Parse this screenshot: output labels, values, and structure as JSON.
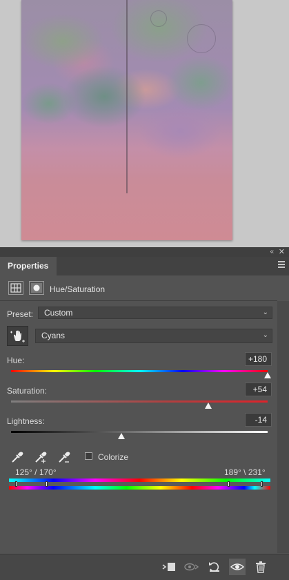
{
  "panel": {
    "tab_label": "Properties",
    "adjustment_title": "Hue/Saturation"
  },
  "preset": {
    "label": "Preset:",
    "value": "Custom"
  },
  "channel": {
    "value": "Cyans"
  },
  "hue": {
    "label": "Hue:",
    "value": "+180",
    "level_fraction": 1.0
  },
  "saturation": {
    "label": "Saturation:",
    "value": "+54",
    "level_fraction": 0.77
  },
  "lightness": {
    "label": "Lightness:",
    "value": "-14",
    "level_fraction": 0.43
  },
  "colorize": {
    "label": "Colorize",
    "checked": false
  },
  "range": {
    "left_label": "125° / 170°",
    "right_label": "189° \\ 231°"
  },
  "icons": {
    "collapse": "double-chevron-icon",
    "close": "close-icon",
    "panel_menu": "hamburger-icon",
    "adjustment": "hue-saturation-icon",
    "mask": "mask-icon",
    "target_adjust": "hand-target-icon",
    "eyedropper": "eyedropper-icon",
    "eyedropper_add": "eyedropper-plus-icon",
    "eyedropper_subtract": "eyedropper-minus-icon",
    "clip": "clip-to-layer-icon",
    "view_previous": "view-previous-icon",
    "reset": "reset-icon",
    "visibility": "eye-icon",
    "delete": "trash-icon"
  },
  "colors": {
    "panel_bg": "#535353",
    "canvas_bg": "#c8c8c8",
    "accent_red": "#e0222a"
  }
}
